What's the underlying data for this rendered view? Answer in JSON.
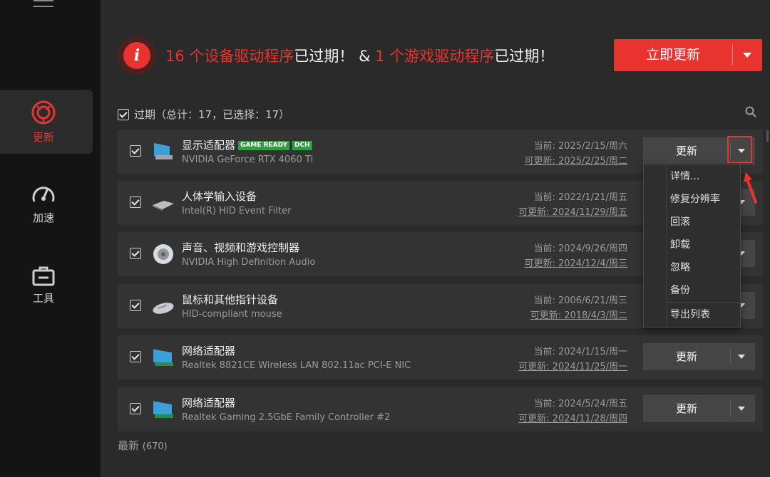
{
  "sidebar": {
    "items": [
      {
        "label": "更新",
        "icon": "update-icon",
        "active": true
      },
      {
        "label": "加速",
        "icon": "speedometer-icon",
        "active": false
      },
      {
        "label": "工具",
        "icon": "toolbox-icon",
        "active": false
      }
    ]
  },
  "header": {
    "count1": "16",
    "text1": " 个设备驱动程序",
    "text2": "已过期！ & ",
    "count2": "1",
    "text3": " 个游戏驱动程序",
    "text4": "已过期！",
    "update_all_label": "立即更新"
  },
  "section": {
    "label": "过期（总计：17，已选择：17）"
  },
  "devices": [
    {
      "name": "显示适配器",
      "badges": [
        "GAME READY",
        "DCH"
      ],
      "driver": "NVIDIA GeForce RTX 4060 Ti",
      "current": "当前: 2025/2/15/周六",
      "available": "可更新: 2025/2/25/周二",
      "icon": "display-adapter-icon"
    },
    {
      "name": "人体学输入设备",
      "badges": [],
      "driver": "Intel(R) HID Event Filter",
      "current": "当前: 2022/1/21/周五",
      "available": "可更新: 2024/11/29/周五",
      "icon": "hid-device-icon"
    },
    {
      "name": "声音、视频和游戏控制器",
      "badges": [],
      "driver": "NVIDIA High Definition Audio",
      "current": "当前: 2024/9/26/周四",
      "available": "可更新: 2024/12/4/周三",
      "icon": "speaker-icon"
    },
    {
      "name": "鼠标和其他指针设备",
      "badges": [],
      "driver": "HID-compliant mouse",
      "current": "当前: 2006/6/21/周三",
      "available": "可更新: 2018/4/3/周二",
      "icon": "mouse-icon"
    },
    {
      "name": "网络适配器",
      "badges": [],
      "driver": "Realtek 8821CE Wireless LAN 802.11ac PCI-E NIC",
      "current": "当前: 2024/1/15/周一",
      "available": "可更新: 2024/11/25/周一",
      "icon": "network-adapter-icon"
    },
    {
      "name": "网络适配器",
      "badges": [],
      "driver": "Realtek Gaming 2.5GbE Family Controller #2",
      "current": "当前: 2024/5/24/周五",
      "available": "可更新: 2024/11/28/周四",
      "icon": "network-adapter-icon"
    }
  ],
  "update_button_label": "更新",
  "dropdown_menu": [
    "详情...",
    "修复分辨率",
    "回滚",
    "卸载",
    "忽略",
    "备份",
    "导出列表"
  ],
  "latest": {
    "label": "最新",
    "count": "(670)"
  },
  "colors": {
    "accent": "#e8332e",
    "badge_green": "#2ea043",
    "background": "#2a2a2a",
    "sidebar": "#141414"
  }
}
